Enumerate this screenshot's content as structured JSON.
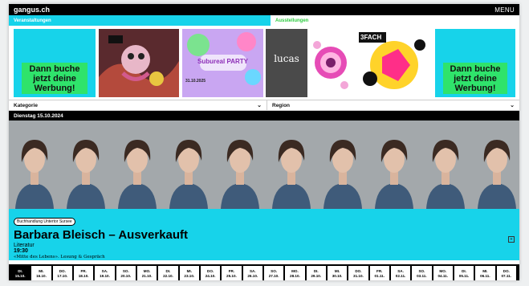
{
  "site": {
    "logo": "gangus.ch",
    "menu_label": "MENU"
  },
  "sections": {
    "left": "Veranstaltungen",
    "right": "Ausstellungen"
  },
  "ads": {
    "left_cta": "Dann buche jetzt deine Werbung!",
    "right_cta": "Dann buche jetzt deine Werbung!"
  },
  "posters": {
    "party_title": "Subureal PARTY",
    "party_date": "31.10.2025",
    "tile_word": "lucas",
    "expo_word": "3FACH"
  },
  "filters": {
    "category": "Kategorie",
    "region": "Region"
  },
  "date_heading": "Dienstag 15.10.2024",
  "event": {
    "venue_tag": "Buchhandlung Untertor Sursee",
    "title": "Barbara Bleisch – Ausverkauft",
    "category": "Literatur",
    "time": "19:30",
    "description": "«Mitte des Lebens». Lesung & Gespräch",
    "expand_icon": "plus-icon"
  },
  "days": [
    {
      "d": "DI.",
      "date": "15.10."
    },
    {
      "d": "MI.",
      "date": "16.10."
    },
    {
      "d": "DO.",
      "date": "17.10."
    },
    {
      "d": "FR.",
      "date": "18.10."
    },
    {
      "d": "SA.",
      "date": "19.10."
    },
    {
      "d": "SO.",
      "date": "20.10."
    },
    {
      "d": "MO.",
      "date": "21.10."
    },
    {
      "d": "DI.",
      "date": "22.10."
    },
    {
      "d": "MI.",
      "date": "23.10."
    },
    {
      "d": "DO.",
      "date": "24.10."
    },
    {
      "d": "FR.",
      "date": "25.10."
    },
    {
      "d": "SA.",
      "date": "26.10."
    },
    {
      "d": "SO.",
      "date": "27.10."
    },
    {
      "d": "MO.",
      "date": "28.10."
    },
    {
      "d": "DI.",
      "date": "29.10."
    },
    {
      "d": "MI.",
      "date": "30.10."
    },
    {
      "d": "DO.",
      "date": "31.10."
    },
    {
      "d": "FR.",
      "date": "01.11."
    },
    {
      "d": "SA.",
      "date": "02.11."
    },
    {
      "d": "SO.",
      "date": "03.11."
    },
    {
      "d": "MO.",
      "date": "04.11."
    },
    {
      "d": "DI.",
      "date": "05.11."
    },
    {
      "d": "MI.",
      "date": "06.11."
    },
    {
      "d": "DO.",
      "date": "07.11."
    }
  ],
  "colors": {
    "accent_cyan": "#17d3ea",
    "accent_green": "#2fe36b",
    "section_green": "#2ecc40"
  }
}
